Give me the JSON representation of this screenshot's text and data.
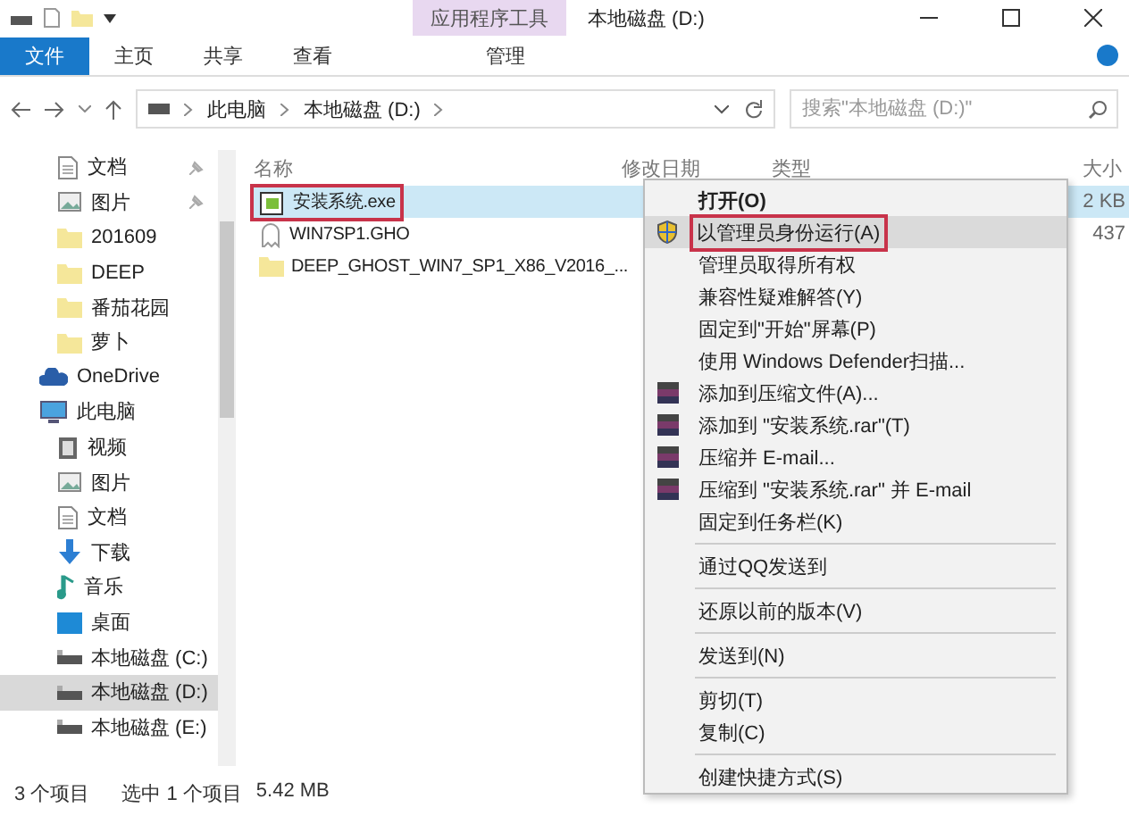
{
  "window": {
    "title": "本地磁盘 (D:)",
    "context_tab": "应用程序工具"
  },
  "ribbon_tabs": [
    {
      "label": "文件",
      "selected": true
    },
    {
      "label": "主页",
      "selected": false
    },
    {
      "label": "共享",
      "selected": false
    },
    {
      "label": "查看",
      "selected": false
    },
    {
      "label": "管理",
      "selected": false
    }
  ],
  "address": {
    "crumbs": [
      "此电脑",
      "本地磁盘 (D:)"
    ]
  },
  "search": {
    "placeholder": "搜索\"本地磁盘 (D:)\""
  },
  "sidebar": {
    "quick_access": [
      {
        "label": "文档",
        "kind": "document",
        "pinned": true
      },
      {
        "label": "图片",
        "kind": "picture",
        "pinned": true
      },
      {
        "label": "201609",
        "kind": "folder",
        "pinned": false
      },
      {
        "label": "DEEP",
        "kind": "folder",
        "pinned": false
      },
      {
        "label": "番茄花园",
        "kind": "folder",
        "pinned": false
      },
      {
        "label": "萝卜",
        "kind": "folder",
        "pinned": false
      }
    ],
    "roots": [
      {
        "label": "OneDrive",
        "kind": "cloud",
        "selected": false
      },
      {
        "label": "此电脑",
        "kind": "pc",
        "selected": false,
        "children": [
          {
            "label": "视频",
            "kind": "video",
            "selected": false
          },
          {
            "label": "图片",
            "kind": "picture",
            "selected": false
          },
          {
            "label": "文档",
            "kind": "document",
            "selected": false
          },
          {
            "label": "下载",
            "kind": "download",
            "selected": false
          },
          {
            "label": "音乐",
            "kind": "music",
            "selected": false
          },
          {
            "label": "桌面",
            "kind": "desktop",
            "selected": false
          },
          {
            "label": "本地磁盘 (C:)",
            "kind": "drive",
            "selected": false
          },
          {
            "label": "本地磁盘 (D:)",
            "kind": "drive",
            "selected": true
          },
          {
            "label": "本地磁盘 (E:)",
            "kind": "drive",
            "selected": false
          }
        ]
      }
    ]
  },
  "table": {
    "columns": [
      "名称",
      "修改日期",
      "类型",
      "大小"
    ],
    "rows": [
      {
        "name": "安装系统.exe",
        "kind": "exe",
        "size": "2 KB",
        "selected": true,
        "highlighted": true
      },
      {
        "name": "WIN7SP1.GHO",
        "kind": "ghost",
        "size": "437",
        "selected": false,
        "highlighted": false
      },
      {
        "name": "DEEP_GHOST_WIN7_SP1_X86_V2016_...",
        "kind": "folder",
        "selected": false,
        "highlighted": false
      }
    ]
  },
  "context_menu": {
    "items": [
      {
        "kind": "plain",
        "label": "打开(O)",
        "bold": true,
        "hovered": false,
        "highlighted": false
      },
      {
        "kind": "admin",
        "label": "以管理员身份运行(A)",
        "bold": false,
        "hovered": true,
        "highlighted": true
      },
      {
        "kind": "plain",
        "label": "管理员取得所有权",
        "bold": false,
        "hovered": false,
        "highlighted": false
      },
      {
        "kind": "plain",
        "label": "兼容性疑难解答(Y)",
        "bold": false,
        "hovered": false,
        "highlighted": false
      },
      {
        "kind": "plain",
        "label": "固定到\"开始\"屏幕(P)",
        "bold": false,
        "hovered": false,
        "highlighted": false
      },
      {
        "kind": "plain",
        "label": "使用 Windows Defender扫描...",
        "bold": false,
        "hovered": false,
        "highlighted": false
      },
      {
        "kind": "archive",
        "label": "添加到压缩文件(A)...",
        "bold": false,
        "hovered": false,
        "highlighted": false
      },
      {
        "kind": "archive",
        "label": "添加到 \"安装系统.rar\"(T)",
        "bold": false,
        "hovered": false,
        "highlighted": false
      },
      {
        "kind": "archive",
        "label": "压缩并 E-mail...",
        "bold": false,
        "hovered": false,
        "highlighted": false
      },
      {
        "kind": "archive",
        "label": "压缩到 \"安装系统.rar\" 并 E-mail",
        "bold": false,
        "hovered": false,
        "highlighted": false
      },
      {
        "kind": "plain",
        "label": "固定到任务栏(K)",
        "bold": false,
        "hovered": false,
        "highlighted": false
      },
      {
        "kind": "separator"
      },
      {
        "kind": "plain",
        "label": "通过QQ发送到",
        "bold": false,
        "hovered": false,
        "highlighted": false
      },
      {
        "kind": "separator"
      },
      {
        "kind": "plain",
        "label": "还原以前的版本(V)",
        "bold": false,
        "hovered": false,
        "highlighted": false
      },
      {
        "kind": "separator"
      },
      {
        "kind": "plain",
        "label": "发送到(N)",
        "bold": false,
        "hovered": false,
        "highlighted": false
      },
      {
        "kind": "separator"
      },
      {
        "kind": "plain",
        "label": "剪切(T)",
        "bold": false,
        "hovered": false,
        "highlighted": false
      },
      {
        "kind": "plain",
        "label": "复制(C)",
        "bold": false,
        "hovered": false,
        "highlighted": false
      },
      {
        "kind": "separator"
      },
      {
        "kind": "plain",
        "label": "创建快捷方式(S)",
        "bold": false,
        "hovered": false,
        "highlighted": false
      }
    ]
  },
  "status_bar": {
    "count": "3 个项目",
    "selection": "选中 1 个项目",
    "size": "5.42 MB"
  }
}
